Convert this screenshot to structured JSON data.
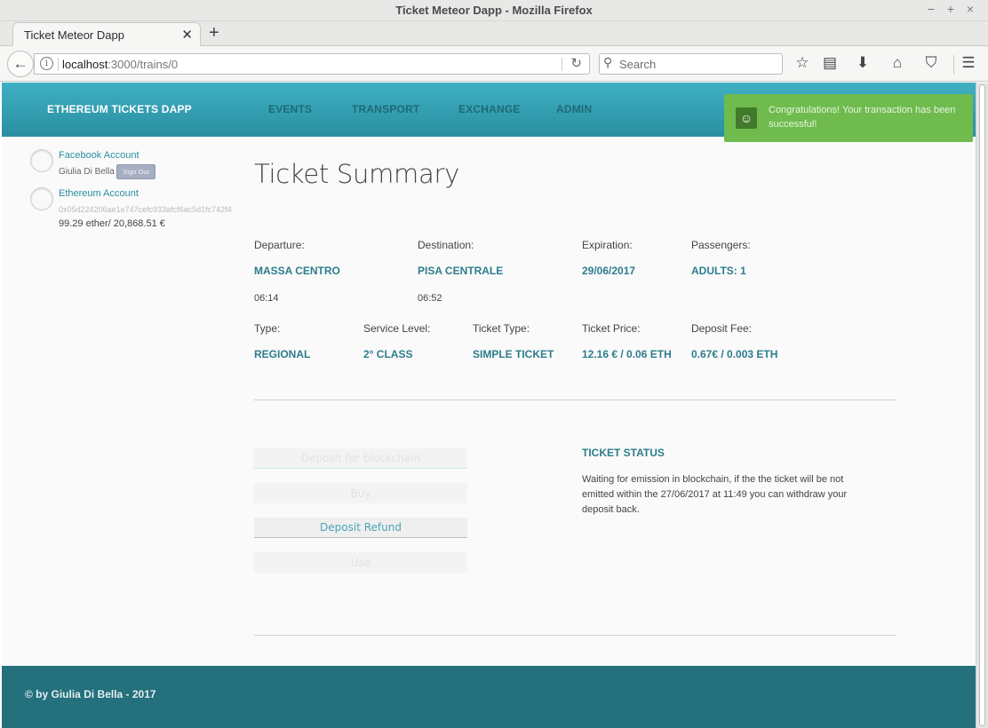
{
  "window": {
    "title": "Ticket Meteor Dapp - Mozilla Firefox",
    "controls": [
      "−",
      "+",
      "×"
    ]
  },
  "browser": {
    "tab_title": "Ticket Meteor Dapp",
    "url_host": "localhost",
    "url_rest": ":3000/trains/0",
    "search_placeholder": "Search"
  },
  "header": {
    "brand": "ETHEREUM TICKETS DAPP",
    "nav": [
      "EVENTS",
      "TRANSPORT",
      "EXCHANGE",
      "ADMIN"
    ]
  },
  "toast": {
    "message": "Congratulations! Your transaction has been successful!"
  },
  "sidebar": {
    "facebook_label": "Facebook Account",
    "user_name": "Giulia Di Bella",
    "signout_label": "Sign Out",
    "ethereum_label": "Ethereum Account",
    "address": "0x05d224206ae1e747cefc933afcf6ac5d1fc742f4",
    "balance": "99.29 ether/ 20,868.51 €"
  },
  "summary": {
    "title": "Ticket Summary",
    "departure_label": "Departure:",
    "departure": "MASSA CENTRO",
    "departure_time": "06:14",
    "destination_label": "Destination:",
    "destination": "PISA CENTRALE",
    "destination_time": "06:52",
    "expiration_label": "Expiration:",
    "expiration": "29/06/2017",
    "passengers_label": "Passengers:",
    "passengers": "ADULTS: 1",
    "type_label": "Type:",
    "type": "REGIONAL",
    "service_label": "Service Level:",
    "service": "2° CLASS",
    "ticket_type_label": "Ticket Type:",
    "ticket_type": "SIMPLE TICKET",
    "price_label": "Ticket Price:",
    "price": "12.16 € / 0.06 ETH",
    "deposit_label": "Deposit Fee:",
    "deposit": "0.67€ / 0.003 ETH"
  },
  "actions": {
    "deposit_blockchain": "Deposit for blockchain",
    "buy": "Buy",
    "deposit_refund": "Deposit Refund",
    "use": "Use"
  },
  "status": {
    "heading": "TICKET STATUS",
    "text": "Waiting for emission in blockchain, if the the ticket will be not emitted within the 27/06/2017 at 11:49 you can withdraw your deposit back."
  },
  "footer": {
    "text": "© by Giulia Di Bella - 2017"
  },
  "colors": {
    "header": "#3fb0c4",
    "accent": "#2c7d8c",
    "toast": "#6fbb4e",
    "footer": "#24707c"
  }
}
